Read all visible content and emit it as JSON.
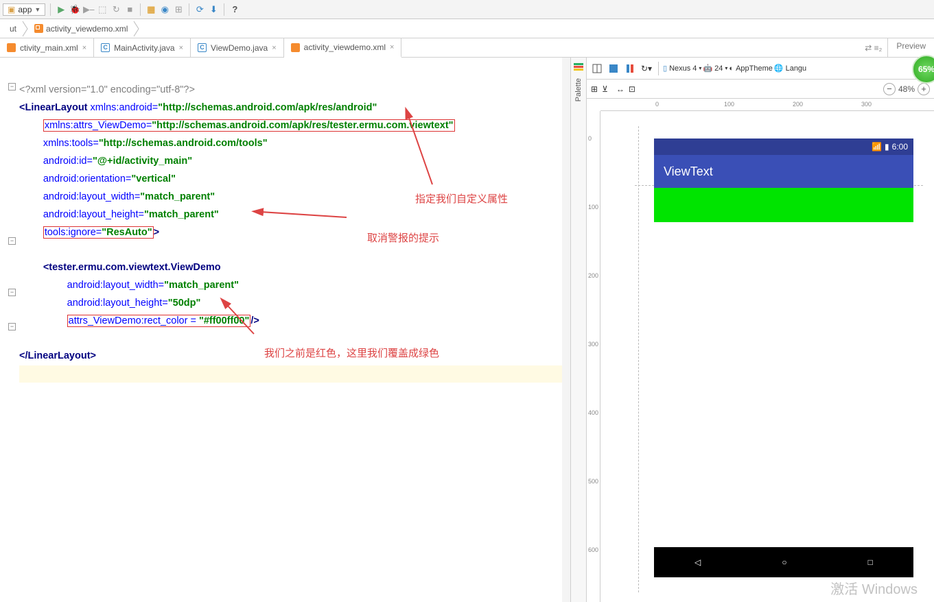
{
  "toolbar": {
    "module_label": "app",
    "run_icon": "run-icon",
    "debug_icon": "debug-icon",
    "help_icon": "?"
  },
  "breadcrumb": {
    "items": [
      "ut",
      "activity_viewdemo.xml"
    ]
  },
  "tabs": [
    {
      "label": "ctivity_main.xml",
      "type": "xml",
      "closable": true
    },
    {
      "label": "MainActivity.java",
      "type": "java",
      "closable": true
    },
    {
      "label": "ViewDemo.java",
      "type": "java",
      "closable": true
    },
    {
      "label": "activity_viewdemo.xml",
      "type": "xml",
      "closable": true,
      "active": true
    }
  ],
  "preview_title": "Preview",
  "palette_label": "Palette",
  "device_selector": "Nexus 4",
  "api_selector": "24",
  "theme_selector": "AppTheme",
  "lang_selector": "Langu",
  "zoom_percent": "48%",
  "badge": "65%",
  "ruler_h_ticks": [
    "0",
    "100",
    "200",
    "300"
  ],
  "ruler_v_ticks": [
    "0",
    "100",
    "200",
    "300",
    "400",
    "500",
    "600"
  ],
  "phone": {
    "time": "6:00",
    "title": "ViewText"
  },
  "code": {
    "l1": "<?xml version=\"1.0\" encoding=\"utf-8\"?>",
    "l2_a": "<LinearLayout ",
    "l2_b": "xmlns:android=",
    "l2_c": "\"http://schemas.android.com/apk/res/android\"",
    "l3_a": "xmlns:attrs_ViewDemo=",
    "l3_b": "\"http://schemas.android.com/apk/res/tester.ermu.com.viewtext\"",
    "l4_a": "xmlns:tools=",
    "l4_b": "\"http://schemas.android.com/tools\"",
    "l5_a": "android:id=",
    "l5_b": "\"@+id/activity_main\"",
    "l6_a": "android:orientation=",
    "l6_b": "\"vertical\"",
    "l7_a": "android:layout_width=",
    "l7_b": "\"match_parent\"",
    "l8_a": "android:layout_height=",
    "l8_b": "\"match_parent\"",
    "l9_a": "tools:ignore=",
    "l9_b": "\"ResAuto\"",
    "l9_c": ">",
    "l10": "<tester.ermu.com.viewtext.ViewDemo",
    "l11_a": "android:layout_width=",
    "l11_b": "\"match_parent\"",
    "l12_a": "android:layout_height=",
    "l12_b": "\"50dp\"",
    "l13_a": "attrs_ViewDemo:rect_color = ",
    "l13_b": "\"#ff00ff00\"",
    "l13_c": "/>",
    "l14": "</LinearLayout>"
  },
  "annotations": {
    "a1": "指定我们自定义属性",
    "a2": "取消警报的提示",
    "a3": "我们之前是红色，这里我们覆盖成绿色"
  },
  "watermark": "激活 Windows"
}
